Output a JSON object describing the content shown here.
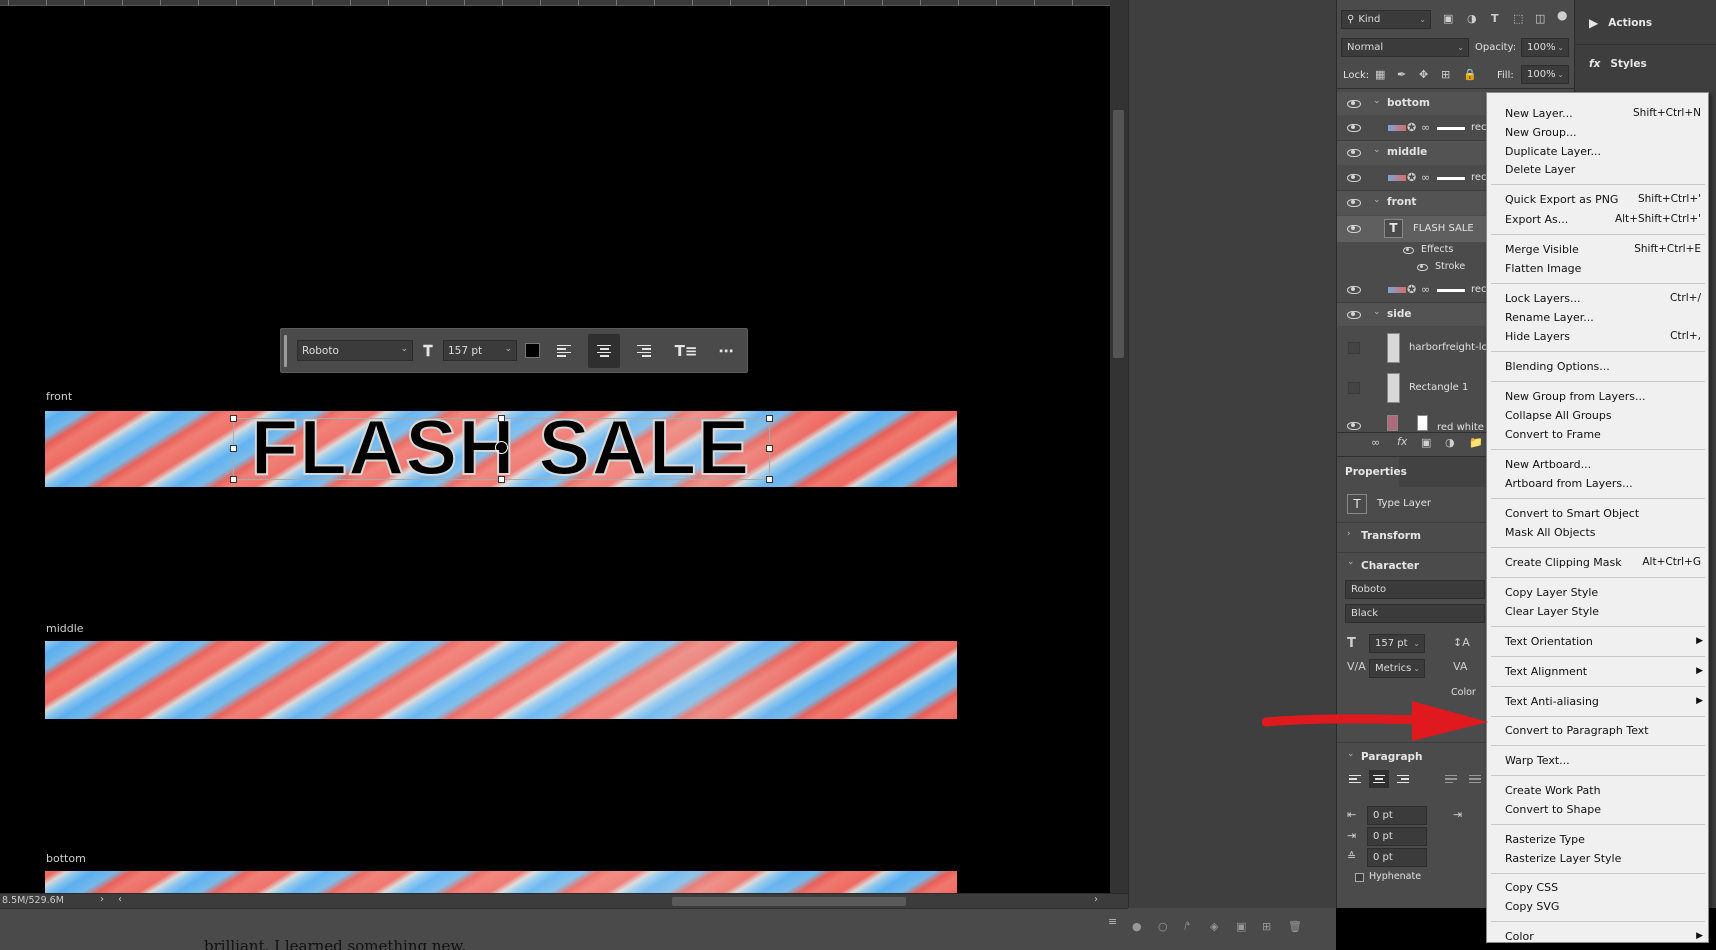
{
  "canvas": {
    "artboards": [
      {
        "label": "front"
      },
      {
        "label": "middle"
      },
      {
        "label": "bottom"
      }
    ],
    "banner_text": "FLASH SALE",
    "status_doc_size": "8.5M/529.6M"
  },
  "type_toolbar": {
    "font_family": "Roboto",
    "font_size": "157 pt",
    "color": "#000000",
    "active_alignment": "center"
  },
  "layers_panel": {
    "filter_kind": "Kind",
    "blend_mode": "Normal",
    "opacity_label": "Opacity:",
    "opacity_value": "100%",
    "lock_label": "Lock:",
    "fill_label": "Fill:",
    "fill_value": "100%",
    "groups": {
      "bottom": {
        "name": "bottom",
        "child": "rec"
      },
      "middle": {
        "name": "middle",
        "child": "rec"
      },
      "front": {
        "name": "front",
        "text_layer": "FLASH SALE",
        "effects": "Effects",
        "stroke": "Stroke",
        "child": "rec"
      },
      "side": {
        "name": "side",
        "layers": [
          "harborfreight-log",
          "Rectangle 1",
          "red white b"
        ]
      }
    }
  },
  "properties": {
    "tab": "Properties",
    "layer_type": "Type Layer",
    "transform": "Transform",
    "character": "Character",
    "font_family": "Roboto",
    "font_style": "Black",
    "font_size": "157 pt",
    "kerning": "Metrics",
    "color_label": "Color",
    "paragraph": "Paragraph",
    "indent_left": "0 pt",
    "indent_first": "0 pt",
    "space_before": "0 pt",
    "hyphenate": "Hyphenate"
  },
  "right_panel": {
    "actions": "Actions",
    "styles": "Styles"
  },
  "context_menu": {
    "items": [
      {
        "label": "New Layer...",
        "shortcut": "Shift+Ctrl+N"
      },
      {
        "label": "New Group...",
        "shortcut": ""
      },
      {
        "label": "Duplicate Layer...",
        "shortcut": ""
      },
      {
        "label": "Delete Layer",
        "shortcut": ""
      },
      {
        "label": "Quick Export as PNG",
        "shortcut": "Shift+Ctrl+'"
      },
      {
        "label": "Export As...",
        "shortcut": "Alt+Shift+Ctrl+'"
      },
      {
        "label": "Merge Visible",
        "shortcut": "Shift+Ctrl+E"
      },
      {
        "label": "Flatten Image",
        "shortcut": ""
      },
      {
        "label": "Lock Layers...",
        "shortcut": "Ctrl+/"
      },
      {
        "label": "Rename Layer...",
        "shortcut": ""
      },
      {
        "label": "Hide Layers",
        "shortcut": "Ctrl+,"
      },
      {
        "label": "Blending Options...",
        "shortcut": ""
      },
      {
        "label": "New Group from Layers...",
        "shortcut": ""
      },
      {
        "label": "Collapse All Groups",
        "shortcut": ""
      },
      {
        "label": "Convert to Frame",
        "shortcut": ""
      },
      {
        "label": "New Artboard...",
        "shortcut": ""
      },
      {
        "label": "Artboard from Layers...",
        "shortcut": ""
      },
      {
        "label": "Convert to Smart Object",
        "shortcut": ""
      },
      {
        "label": "Mask All Objects",
        "shortcut": ""
      },
      {
        "label": "Create Clipping Mask",
        "shortcut": "Alt+Ctrl+G"
      },
      {
        "label": "Copy Layer Style",
        "shortcut": ""
      },
      {
        "label": "Clear Layer Style",
        "shortcut": ""
      },
      {
        "label": "Text Orientation",
        "shortcut": "",
        "submenu": true
      },
      {
        "label": "Text Alignment",
        "shortcut": "",
        "submenu": true
      },
      {
        "label": "Text Anti-aliasing",
        "shortcut": "",
        "submenu": true
      },
      {
        "label": "Convert to Paragraph Text",
        "shortcut": ""
      },
      {
        "label": "Warp Text...",
        "shortcut": ""
      },
      {
        "label": "Create Work Path",
        "shortcut": ""
      },
      {
        "label": "Convert to Shape",
        "shortcut": ""
      },
      {
        "label": "Rasterize Type",
        "shortcut": ""
      },
      {
        "label": "Rasterize Layer Style",
        "shortcut": ""
      },
      {
        "label": "Copy CSS",
        "shortcut": ""
      },
      {
        "label": "Copy SVG",
        "shortcut": ""
      },
      {
        "label": "Color",
        "shortcut": "",
        "submenu": true
      }
    ]
  },
  "bottom_strip": {
    "peek_text": "brilliant. I learned something new."
  },
  "colors": {
    "accent_arrow": "#e0191e",
    "panel_bg": "#4b4b4b",
    "menu_bg": "#f0f0f0"
  }
}
